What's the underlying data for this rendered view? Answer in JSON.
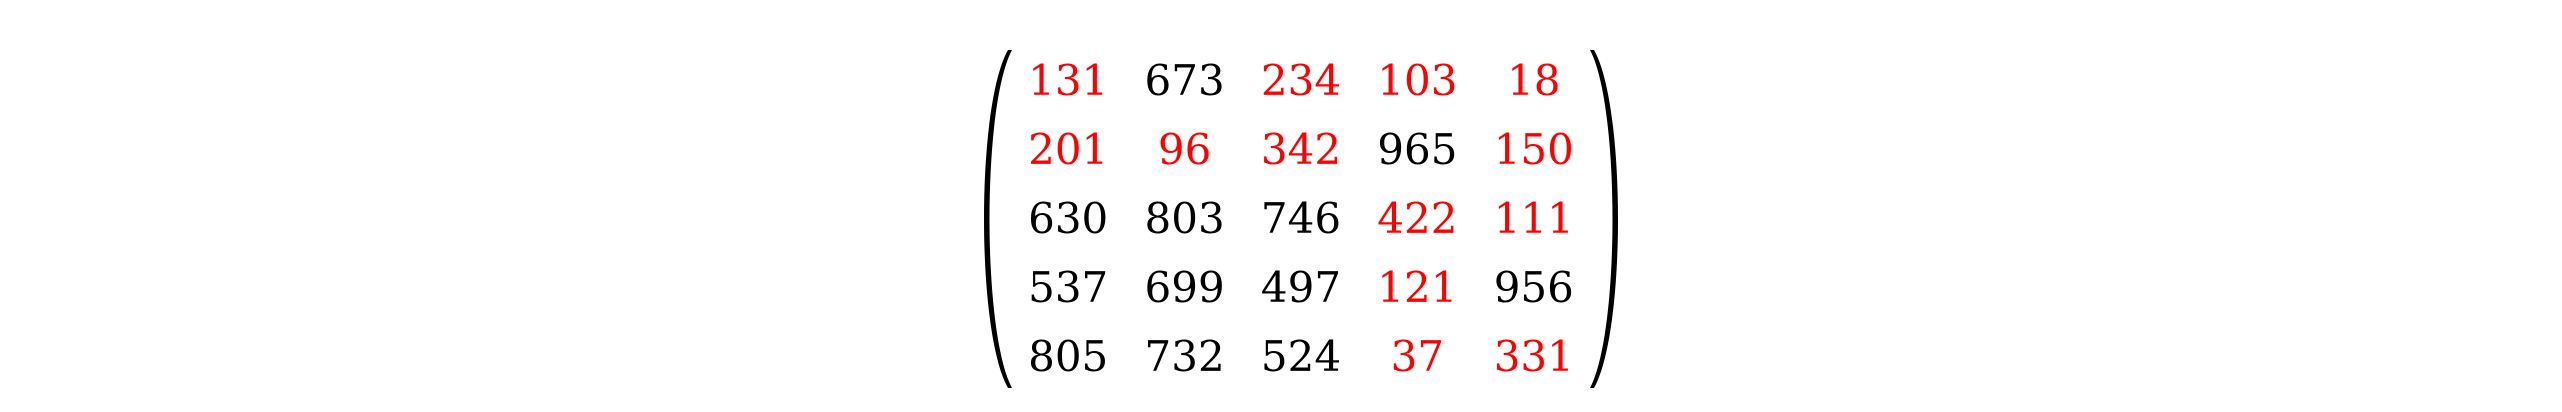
{
  "matrix": {
    "highlight_color": "#ff0000",
    "default_color": "#000000",
    "rows": [
      [
        {
          "value": "131",
          "highlighted": true
        },
        {
          "value": "673",
          "highlighted": false
        },
        {
          "value": "234",
          "highlighted": true
        },
        {
          "value": "103",
          "highlighted": true
        },
        {
          "value": "18",
          "highlighted": true
        }
      ],
      [
        {
          "value": "201",
          "highlighted": true
        },
        {
          "value": "96",
          "highlighted": true
        },
        {
          "value": "342",
          "highlighted": true
        },
        {
          "value": "965",
          "highlighted": false
        },
        {
          "value": "150",
          "highlighted": true
        }
      ],
      [
        {
          "value": "630",
          "highlighted": false
        },
        {
          "value": "803",
          "highlighted": false
        },
        {
          "value": "746",
          "highlighted": false
        },
        {
          "value": "422",
          "highlighted": true
        },
        {
          "value": "111",
          "highlighted": true
        }
      ],
      [
        {
          "value": "537",
          "highlighted": false
        },
        {
          "value": "699",
          "highlighted": false
        },
        {
          "value": "497",
          "highlighted": false
        },
        {
          "value": "121",
          "highlighted": true
        },
        {
          "value": "956",
          "highlighted": false
        }
      ],
      [
        {
          "value": "805",
          "highlighted": false
        },
        {
          "value": "732",
          "highlighted": false
        },
        {
          "value": "524",
          "highlighted": false
        },
        {
          "value": "37",
          "highlighted": true
        },
        {
          "value": "331",
          "highlighted": true
        }
      ]
    ]
  }
}
